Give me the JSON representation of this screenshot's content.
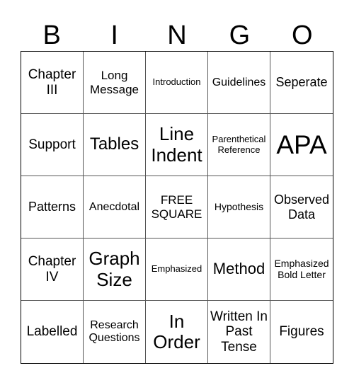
{
  "header": [
    "B",
    "I",
    "N",
    "G",
    "O"
  ],
  "cells": [
    "Chapter III",
    "Long Message",
    "Introduction",
    "Guidelines",
    "Seperate",
    "Support",
    "Tables",
    "Line Indent",
    "Parenthetical Reference",
    "APA",
    "Patterns",
    "Anecdotal",
    "FREE SQUARE",
    "Hypothesis",
    "Observed Data",
    "Chapter IV",
    "Graph Size",
    "Emphasized",
    "Method",
    "Emphasized Bold Letter",
    "Labelled",
    "Research Questions",
    "In Order",
    "Written In Past Tense",
    "Figures"
  ]
}
